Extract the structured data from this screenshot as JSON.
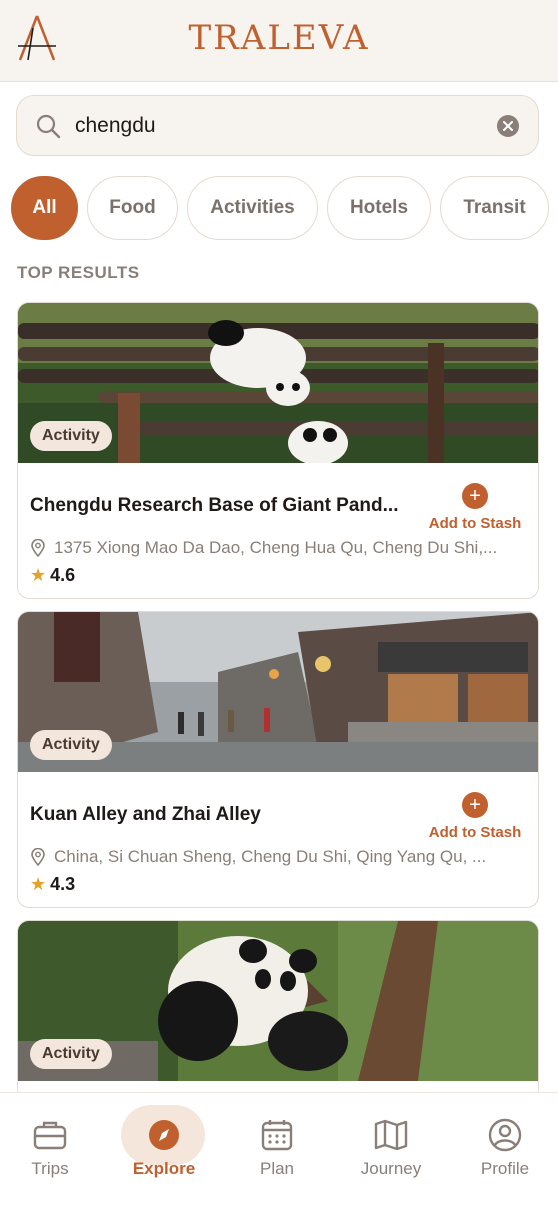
{
  "header": {
    "brand": "TRALEVA"
  },
  "search": {
    "value": "chengdu",
    "placeholder": ""
  },
  "filters": [
    "All",
    "Food",
    "Activities",
    "Hotels",
    "Transit"
  ],
  "active_filter": "All",
  "section_title": "TOP RESULTS",
  "results": [
    {
      "badge": "Activity",
      "name": "Chengdu Research Base of Giant Pand...",
      "stash_label": "Add to Stash",
      "address": "1375 Xiong Mao Da Dao, Cheng Hua Qu, Cheng Du Shi,...",
      "rating": "4.6"
    },
    {
      "badge": "Activity",
      "name": "Kuan Alley and Zhai Alley",
      "stash_label": "Add to Stash",
      "address": "China, Si Chuan Sheng, Cheng Du Shi, Qing Yang Qu, ...",
      "rating": "4.3"
    },
    {
      "badge": "Activity"
    }
  ],
  "tabs": [
    {
      "label": "Trips",
      "icon": "briefcase-icon"
    },
    {
      "label": "Explore",
      "icon": "compass-icon"
    },
    {
      "label": "Plan",
      "icon": "calendar-icon"
    },
    {
      "label": "Journey",
      "icon": "map-icon"
    },
    {
      "label": "Profile",
      "icon": "user-circle-icon"
    }
  ],
  "active_tab": "Explore",
  "colors": {
    "accent": "#c0602f",
    "star": "#e5a12a",
    "header_bg": "#f7f3ee"
  }
}
